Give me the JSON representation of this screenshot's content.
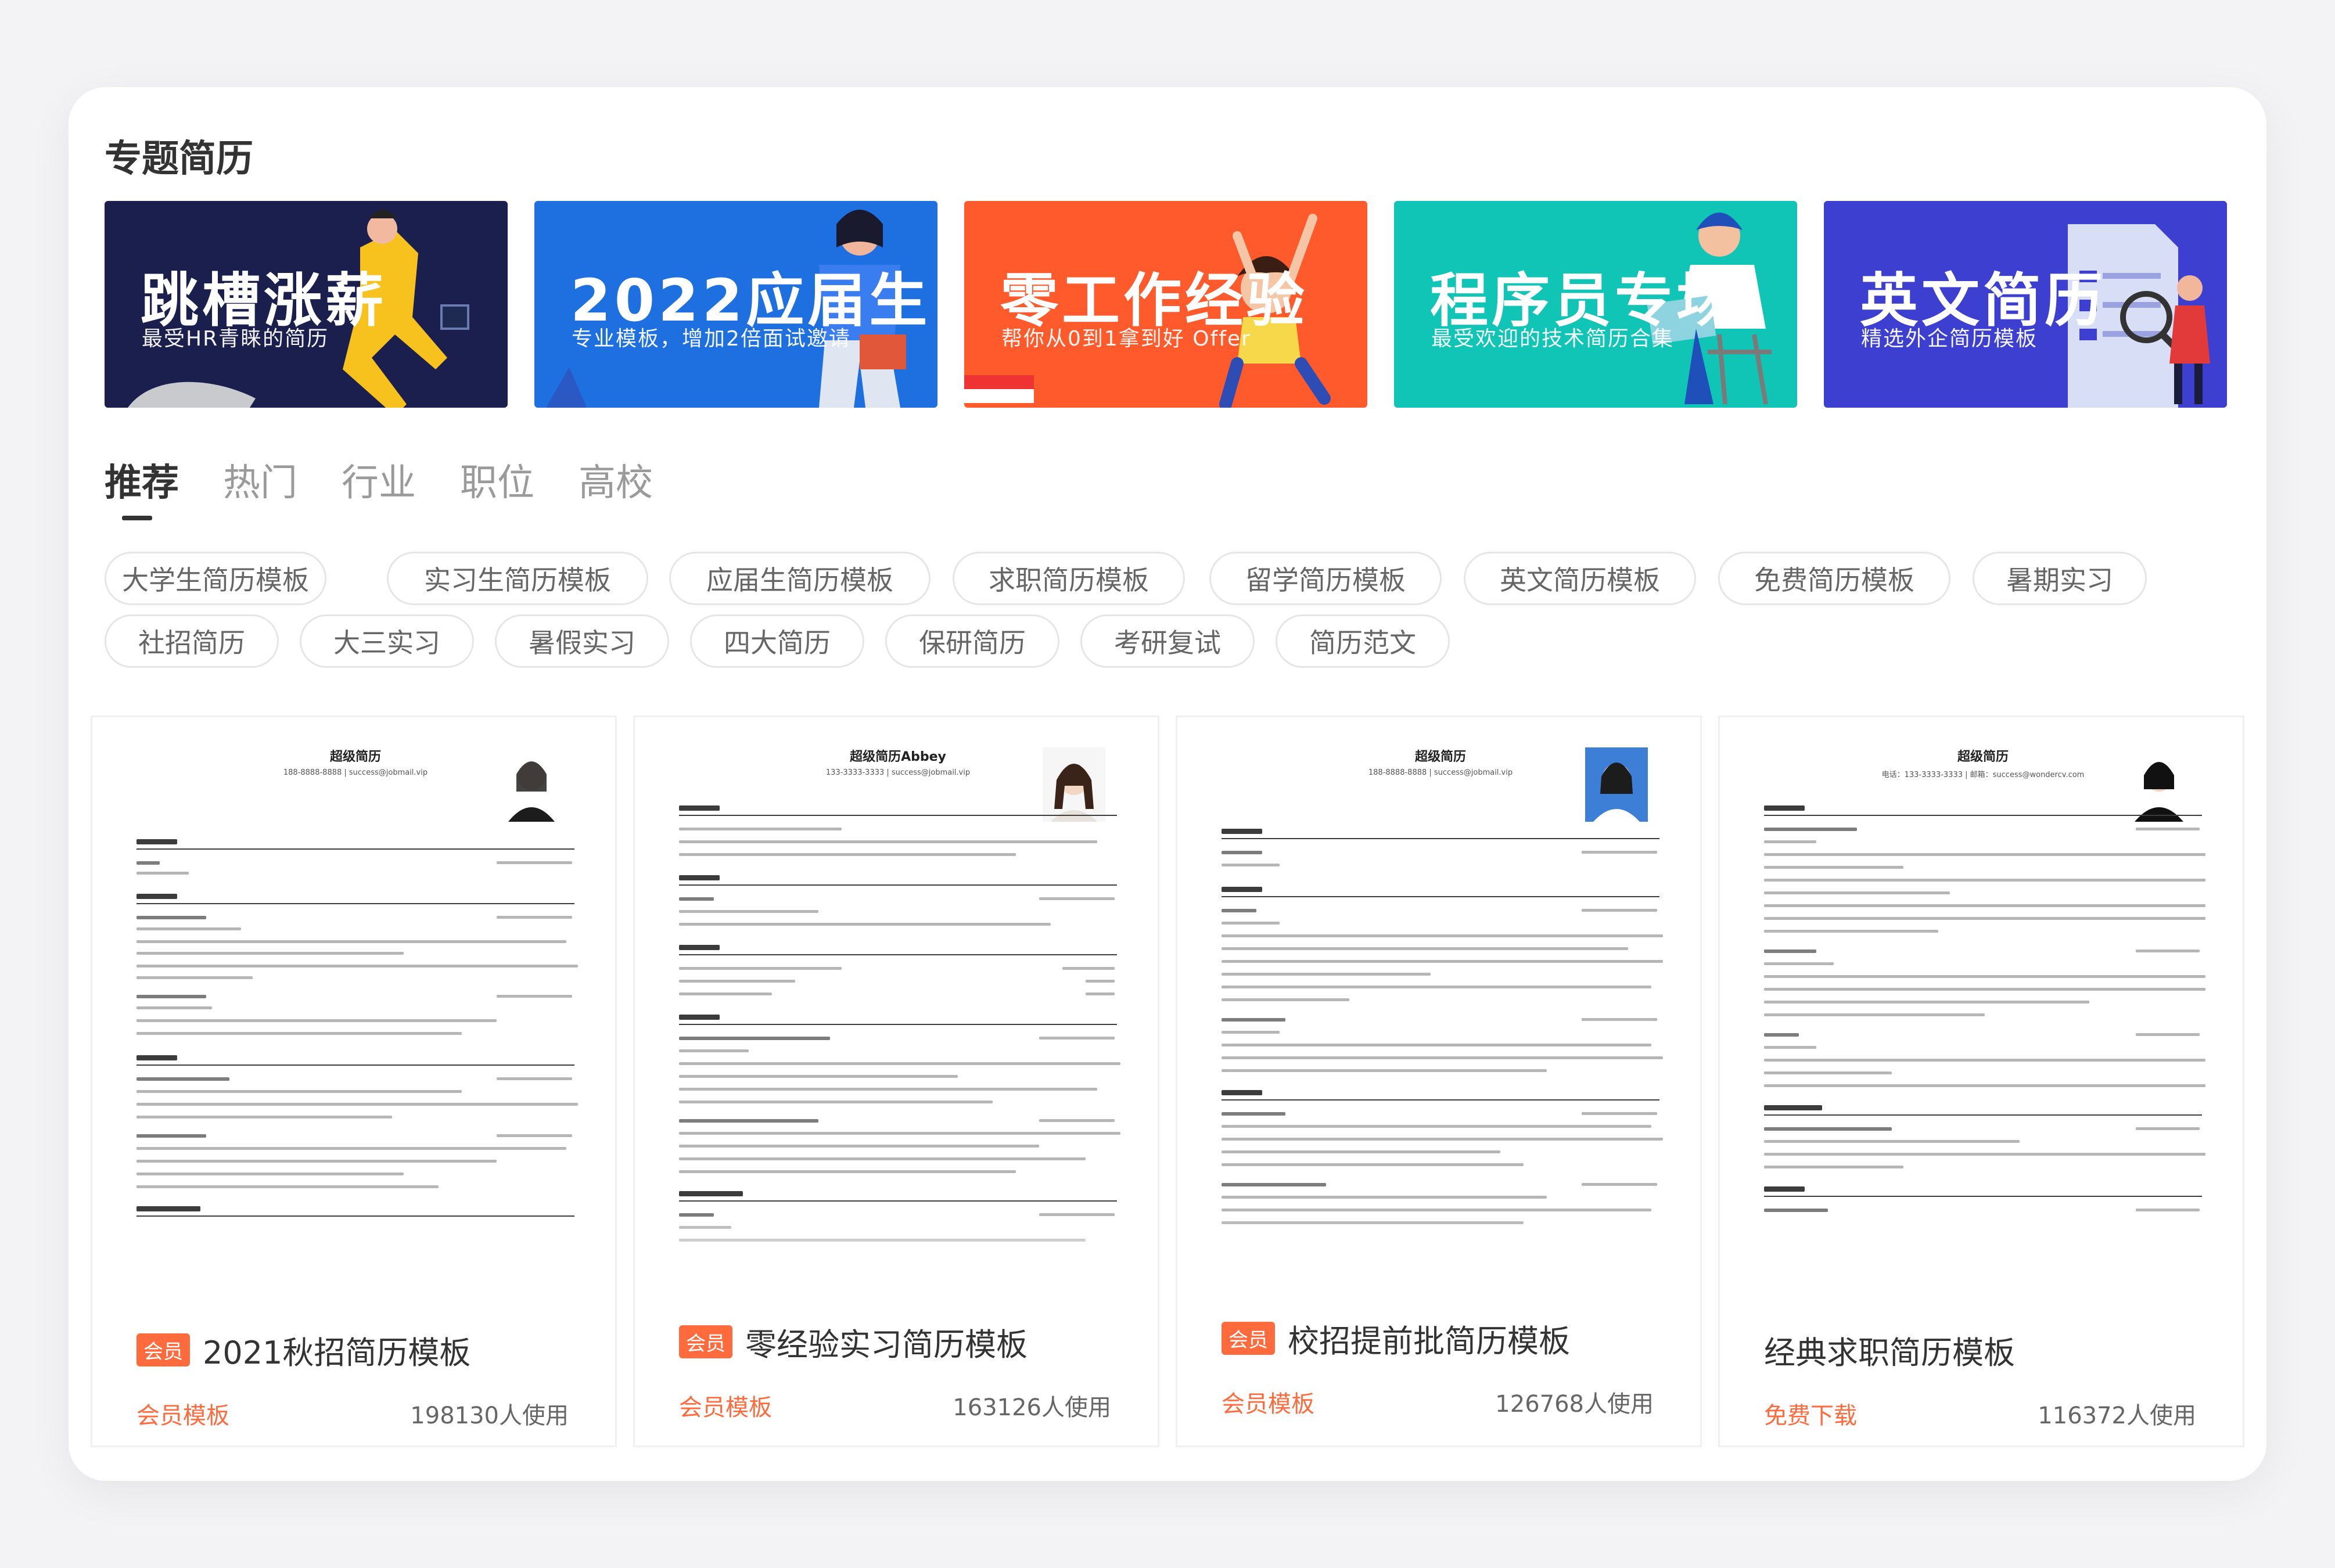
{
  "section_title": "专题简历",
  "banners": [
    {
      "title": "跳槽涨薪",
      "subtitle": "最受HR青睐的简历",
      "color": "#1b1f4e"
    },
    {
      "title": "2022应届生",
      "subtitle": "专业模板，增加2倍面试邀请",
      "color": "#1e6fe0"
    },
    {
      "title": "零工作经验",
      "subtitle": "帮你从0到1拿到好 Offer",
      "color": "#ff5a2b"
    },
    {
      "title": "程序员专场",
      "subtitle": "最受欢迎的技术简历合集",
      "color": "#10c4b6"
    },
    {
      "title": "英文简历",
      "subtitle": "精选外企简历模板",
      "color": "#3d3fd1"
    }
  ],
  "tabs": [
    "推荐",
    "热门",
    "行业",
    "职位",
    "高校"
  ],
  "active_tab": "推荐",
  "tags": [
    "大学生简历模板",
    "实习生简历模板",
    "应届生简历模板",
    "求职简历模板",
    "留学简历模板",
    "英文简历模板",
    "免费简历模板",
    "暑期实习",
    "社招简历",
    "大三实习",
    "暑假实习",
    "四大简历",
    "保研简历",
    "考研复试",
    "简历范文"
  ],
  "cards": [
    {
      "doc_name": "超级简历",
      "doc_contact": "188-8888-8888  |  success@jobmail.vip",
      "badge": "会员",
      "title": "2021秋招简历模板",
      "tag": "会员模板",
      "uses": "198130人使用"
    },
    {
      "doc_name": "超级简历Abbey",
      "doc_contact": "133-3333-3333  |  success@jobmail.vip",
      "badge": "会员",
      "title": "零经验实习简历模板",
      "tag": "会员模板",
      "uses": "163126人使用"
    },
    {
      "doc_name": "超级简历",
      "doc_contact": "188-8888-8888  |  success@jobmail.vip",
      "badge": "会员",
      "title": "校招提前批简历模板",
      "tag": "会员模板",
      "uses": "126768人使用"
    },
    {
      "doc_name": "超级简历",
      "doc_contact": "电话：133-3333-3333  |  邮箱：success@wondercv.com",
      "badge": "",
      "title": "经典求职简历模板",
      "tag": "免费下载",
      "uses": "116372人使用"
    }
  ],
  "colors": {
    "accent": "#ff6b3d",
    "text": "#333333",
    "muted": "#9a9a9a"
  }
}
